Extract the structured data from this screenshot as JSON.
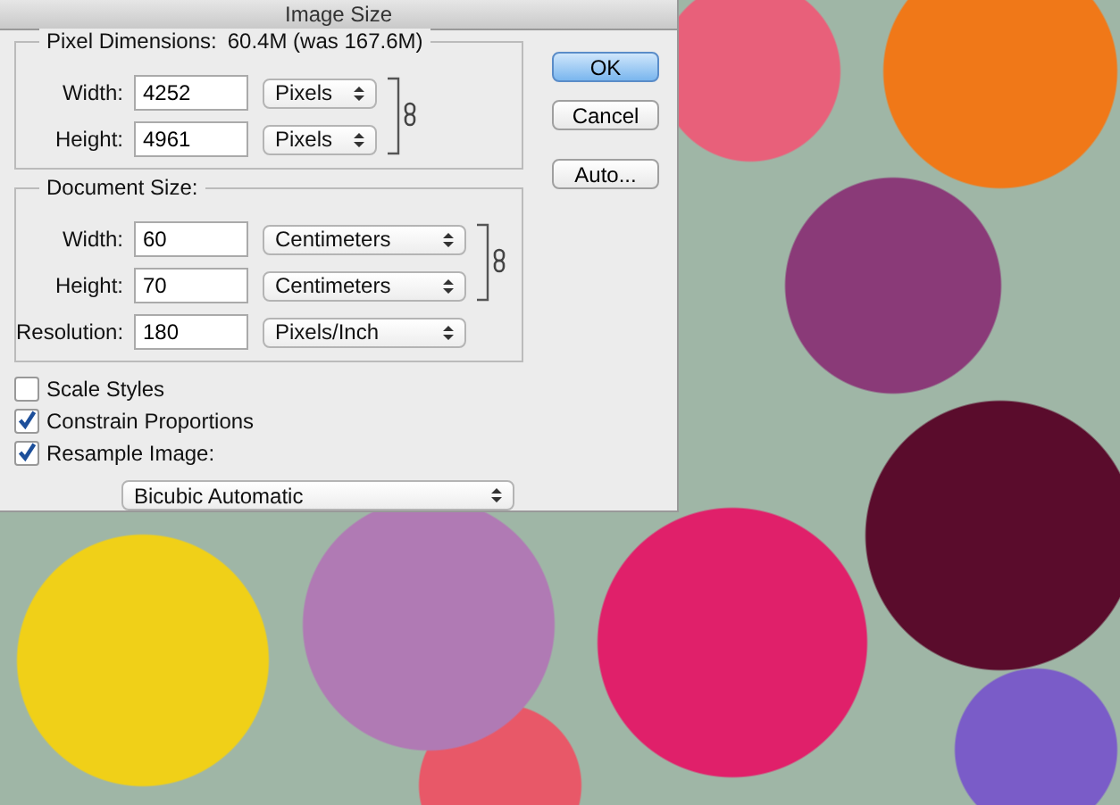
{
  "window": {
    "title": "Image Size"
  },
  "pixel_dimensions": {
    "title": "Pixel Dimensions:",
    "summary": "60.4M (was 167.6M)",
    "fields": [
      {
        "label": "Width:",
        "value": "4252",
        "unit": "Pixels"
      },
      {
        "label": "Height:",
        "value": "4961",
        "unit": "Pixels"
      }
    ]
  },
  "document_size": {
    "title": "Document Size:",
    "fields": [
      {
        "label": "Width:",
        "value": "60",
        "unit": "Centimeters"
      },
      {
        "label": "Height:",
        "value": "70",
        "unit": "Centimeters"
      },
      {
        "label": "Resolution:",
        "value": "180",
        "unit": "Pixels/Inch"
      }
    ]
  },
  "buttons": [
    {
      "label": "OK",
      "default": true
    },
    {
      "label": "Cancel",
      "default": false
    },
    {
      "label": "Auto...",
      "default": false
    }
  ],
  "options": [
    {
      "label": "Scale Styles",
      "checked": false
    },
    {
      "label": "Constrain Proportions",
      "checked": true
    },
    {
      "label": "Resample Image:",
      "checked": true
    }
  ],
  "resample_method": "Bicubic Automatic"
}
